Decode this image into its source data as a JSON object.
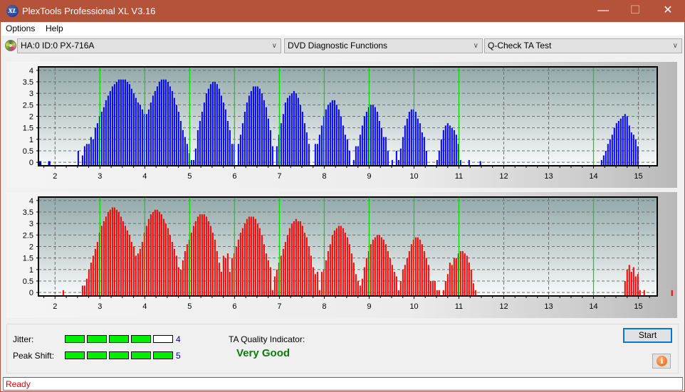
{
  "window": {
    "title": "PlexTools Professional XL V3.16",
    "app_icon_text": "XL",
    "controls": {
      "minimize": "—",
      "maximize": "☐",
      "close": "✕"
    }
  },
  "menu": {
    "items": [
      {
        "label": "Options"
      },
      {
        "label": "Help"
      }
    ]
  },
  "toolbar": {
    "drive_select": "HA:0 ID:0  PX-716A",
    "function_select": "DVD Diagnostic Functions",
    "test_select": "Q-Check TA Test",
    "chevron": "∨"
  },
  "chart_data": [
    {
      "type": "bar",
      "name": "upper-jitter-distribution",
      "color": "#0000ff",
      "marker_color": "#00e000",
      "xlim": [
        1.63,
        15.42
      ],
      "ylim": [
        -0.15,
        4.15
      ],
      "xticks": [
        2,
        3,
        4,
        5,
        6,
        7,
        8,
        9,
        10,
        11,
        12,
        13,
        14,
        15
      ],
      "yticks": [
        0,
        0.5,
        1,
        1.5,
        2,
        2.5,
        3,
        3.5,
        4
      ],
      "ytick_labels": [
        "0",
        "0.5",
        "1",
        "1.5",
        "2",
        "2.5",
        "3",
        "3.5",
        "4"
      ],
      "markers": [
        3,
        4,
        5,
        6,
        7,
        8,
        9,
        10,
        11,
        14
      ],
      "bar_start": 1.66,
      "bar_step": 0.0476,
      "values": [
        0,
        0,
        0,
        0,
        0,
        0,
        0,
        0,
        0,
        0,
        0.0,
        0,
        0,
        0,
        0,
        0,
        0,
        0,
        0.5,
        0,
        0.3,
        0.7,
        0.8,
        0.8,
        1.1,
        1.0,
        1.5,
        1.7,
        2.0,
        2.2,
        2.4,
        2.7,
        2.9,
        3.1,
        3.3,
        3.4,
        3.5,
        3.6,
        3.6,
        3.6,
        3.6,
        3.5,
        3.4,
        3.2,
        3.0,
        2.8,
        2.6,
        2.5,
        2.3,
        2.1,
        2.1,
        2.3,
        2.6,
        2.9,
        3.1,
        3.3,
        3.5,
        3.6,
        3.6,
        3.6,
        3.5,
        3.3,
        3.1,
        2.8,
        2.5,
        2.2,
        1.8,
        1.4,
        1.1,
        0.8,
        0.4,
        0.1,
        0.1,
        0.6,
        1.4,
        1.8,
        2.2,
        2.6,
        3.0,
        3.2,
        3.4,
        3.5,
        3.5,
        3.4,
        3.2,
        2.9,
        2.6,
        2.3,
        1.8,
        1.4,
        0.8,
        0.8,
        0,
        0.8,
        1.2,
        1.7,
        2.2,
        2.6,
        2.9,
        3.1,
        3.3,
        3.3,
        3.3,
        3.2,
        3.0,
        2.7,
        2.4,
        1.9,
        1.4,
        0.7,
        0,
        0.7,
        1.2,
        1.7,
        2.1,
        2.6,
        2.8,
        2.9,
        3.0,
        3.1,
        3.0,
        2.8,
        2.5,
        2.2,
        1.7,
        1.3,
        0.8,
        0,
        0.0,
        0.8,
        0.8,
        1.2,
        1.6,
        2.0,
        2.3,
        2.5,
        2.6,
        2.7,
        2.7,
        2.5,
        2.3,
        2.0,
        1.6,
        1.2,
        1.0,
        0.5,
        0,
        0.1,
        0.7,
        0.7,
        1.2,
        1.6,
        2.0,
        2.2,
        2.4,
        2.5,
        2.5,
        2.4,
        2.2,
        1.8,
        1.5,
        1.1,
        1.1,
        0.5,
        0,
        0.1,
        0,
        0.5,
        0.1,
        0.6,
        1.1,
        1.6,
        1.9,
        2.2,
        2.3,
        2.3,
        2.2,
        1.9,
        1.7,
        1.3,
        1.1,
        0.5,
        0.0,
        0.0,
        0.0,
        0,
        0.1,
        0.5,
        1.0,
        1.4,
        1.6,
        1.7,
        1.6,
        1.5,
        1.4,
        1.2,
        0.8,
        0.1,
        0,
        0,
        0,
        0.1,
        0,
        0,
        0,
        0,
        0,
        0,
        0,
        0,
        0,
        0,
        0,
        0,
        0,
        0,
        0,
        0,
        0,
        0,
        0,
        0,
        0,
        0,
        0,
        0,
        0,
        0,
        0,
        0,
        0,
        0,
        0,
        0,
        0,
        0,
        0,
        0,
        0,
        0,
        0,
        0,
        0,
        0,
        0,
        0,
        0,
        0,
        0,
        0,
        0,
        0,
        0,
        0,
        0,
        0,
        0,
        0,
        0,
        0,
        0,
        0,
        0,
        0.1,
        0.3,
        0.5,
        0.8,
        1.0,
        1.2,
        1.5,
        1.7,
        1.8,
        1.9,
        2.0,
        2.1,
        2.0,
        1.6,
        1.3,
        1.2,
        1.0,
        0.7,
        0,
        0,
        0,
        0,
        0,
        0,
        0,
        0,
        0,
        0,
        0,
        0,
        0,
        0,
        0,
        0,
        0,
        0,
        0,
        0,
        0,
        0,
        0,
        0,
        0
      ],
      "zero_ticks": [
        1.66,
        1.68,
        1.86,
        1.88,
        11.48
      ]
    },
    {
      "type": "bar",
      "name": "lower-peakshift-distribution",
      "color": "#ff0000",
      "marker_color": "#00e000",
      "xlim": [
        1.63,
        15.42
      ],
      "ylim": [
        -0.15,
        4.15
      ],
      "xticks": [
        2,
        3,
        4,
        5,
        6,
        7,
        8,
        9,
        10,
        11,
        12,
        13,
        14,
        15
      ],
      "yticks": [
        0,
        0.5,
        1,
        1.5,
        2,
        2.5,
        3,
        3.5,
        4
      ],
      "ytick_labels": [
        "0",
        "0.5",
        "1",
        "1.5",
        "2",
        "2.5",
        "3",
        "3.5",
        "4"
      ],
      "markers": [
        3,
        4,
        5,
        6,
        7,
        8,
        9,
        10,
        11,
        14
      ],
      "bar_start": 1.66,
      "bar_step": 0.0476,
      "values": [
        0,
        0,
        0,
        0,
        0,
        0,
        0,
        0,
        0,
        0,
        0,
        0.1,
        0,
        0,
        0,
        0,
        0,
        0,
        0,
        0,
        0.3,
        0.3,
        0.6,
        1.0,
        1.3,
        1.6,
        1.9,
        2.2,
        2.6,
        2.9,
        3.1,
        3.3,
        3.5,
        3.6,
        3.7,
        3.7,
        3.6,
        3.5,
        3.3,
        3.1,
        2.9,
        2.7,
        2.5,
        2.2,
        2.0,
        1.6,
        1.7,
        1.9,
        2.2,
        2.6,
        2.9,
        3.2,
        3.4,
        3.5,
        3.6,
        3.6,
        3.5,
        3.4,
        3.2,
        3.0,
        2.8,
        2.5,
        2.2,
        1.9,
        1.6,
        1.1,
        1.0,
        1.4,
        1.8,
        2.1,
        2.3,
        2.6,
        2.9,
        3.1,
        3.3,
        3.4,
        3.4,
        3.4,
        3.3,
        3.1,
        2.9,
        2.6,
        2.3,
        1.8,
        1.3,
        0.9,
        1.6,
        1.5,
        1.7,
        0.9,
        1.5,
        1.7,
        2.0,
        2.3,
        2.6,
        2.8,
        3.0,
        3.2,
        3.3,
        3.3,
        3.3,
        3.2,
        3.0,
        2.8,
        2.5,
        2.1,
        1.7,
        1.4,
        1.1,
        0.1,
        0.7,
        1.0,
        1.3,
        1.6,
        1.9,
        2.2,
        2.5,
        2.8,
        3.0,
        3.1,
        3.2,
        3.1,
        3.1,
        2.9,
        2.6,
        2.4,
        2.0,
        1.6,
        1.1,
        0.8,
        0.9,
        0.1,
        0.9,
        1.0,
        1.4,
        1.8,
        2.1,
        2.5,
        2.7,
        2.8,
        2.9,
        2.9,
        2.8,
        2.6,
        2.4,
        2.1,
        1.7,
        1.3,
        0.8,
        0.5,
        0.3,
        0.6,
        1.1,
        1.5,
        1.8,
        2.1,
        2.3,
        2.4,
        2.5,
        2.5,
        2.4,
        2.3,
        2.1,
        1.8,
        1.5,
        1.2,
        0.9,
        0.7,
        0.1,
        0.5,
        1.0,
        1.2,
        1.5,
        1.8,
        2.1,
        2.3,
        2.4,
        2.4,
        2.3,
        2.1,
        1.8,
        1.5,
        1.2,
        0.5,
        0.5,
        0.5,
        0.1,
        0.1,
        0,
        0.1,
        0.5,
        0.8,
        1.3,
        1.2,
        1.5,
        1.5,
        1.7,
        1.8,
        1.8,
        1.7,
        1.6,
        1.3,
        1.0,
        0.4,
        0.1,
        0,
        0,
        0,
        0,
        0,
        0,
        0,
        0,
        0,
        0,
        0,
        0,
        0,
        0,
        0,
        0,
        0,
        0,
        0,
        0,
        0,
        0,
        0,
        0,
        0,
        0,
        0,
        0,
        0,
        0,
        0,
        0,
        0,
        0,
        0,
        0,
        0,
        0,
        0,
        0,
        0,
        0,
        0,
        0,
        0,
        0,
        0,
        0,
        0,
        0,
        0,
        0,
        0,
        0,
        0,
        0,
        0,
        0,
        0,
        0,
        0,
        0,
        0,
        0,
        0,
        0,
        0,
        0,
        0,
        0.5,
        1.0,
        1.2,
        0.9,
        1.1,
        0.7,
        0.8,
        0.1,
        0,
        0.1,
        0,
        0,
        0,
        0,
        0,
        0,
        0,
        0,
        0,
        0,
        0,
        0,
        0.1,
        0
      ],
      "zero_ticks": []
    }
  ],
  "bottom": {
    "jitter_label": "Jitter:",
    "jitter_value": "4",
    "jitter_level": 4,
    "peak_shift_label": "Peak Shift:",
    "peak_shift_value": "5",
    "peak_shift_level": 5,
    "meter_max": 5,
    "ta_quality_label": "TA Quality Indicator:",
    "ta_quality_value": "Very Good",
    "start_label": "Start",
    "info_icon_text": "i"
  },
  "status": {
    "text": "Ready"
  }
}
